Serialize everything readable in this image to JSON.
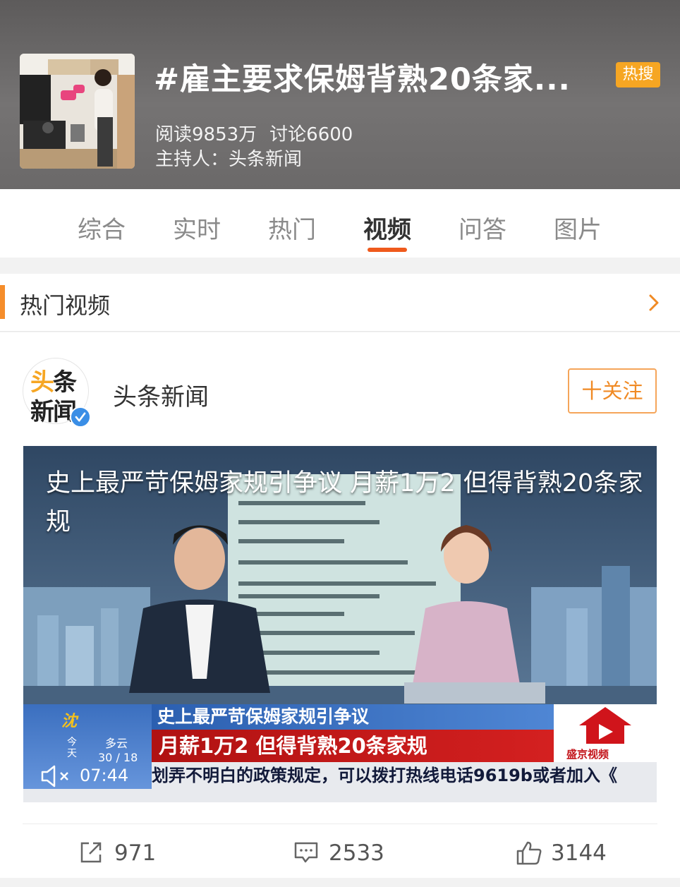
{
  "topic": {
    "title": "#雇主要求保姆背熟20条家...",
    "badge": "热搜",
    "reads": "阅读9853万",
    "discussions": "讨论6600",
    "host": "主持人：头条新闻"
  },
  "tabs": [
    {
      "label": "综合"
    },
    {
      "label": "实时"
    },
    {
      "label": "热门"
    },
    {
      "label": "视频",
      "active": true
    },
    {
      "label": "问答"
    },
    {
      "label": "图片"
    }
  ],
  "section": {
    "title": "热门视频"
  },
  "post": {
    "author": "头条新闻",
    "avatar_text_1a": "头",
    "avatar_text_1b": "条",
    "avatar_text_2": "新闻",
    "follow_label": "十关注",
    "video": {
      "title": "史上最严苛保姆家规引争议 月薪1万2 但得背熟20条家规",
      "lower_third_1": "史上最严苛保姆家规引争议",
      "lower_third_2": "月薪1万2  但得背熟20条家规",
      "weather_day": "今天",
      "weather_cond": "多云",
      "weather_temp": "30 / 18",
      "station": "盛京视频",
      "ticker": "划弄不明白的政策规定，可以拨打热线电话9619b或者加入《",
      "time": "07:44"
    },
    "actions": {
      "share": "971",
      "comment": "2533",
      "like": "3144"
    }
  },
  "colors": {
    "accent": "#ef5a1c",
    "badge": "#f6a623",
    "follow": "#f08a24"
  }
}
